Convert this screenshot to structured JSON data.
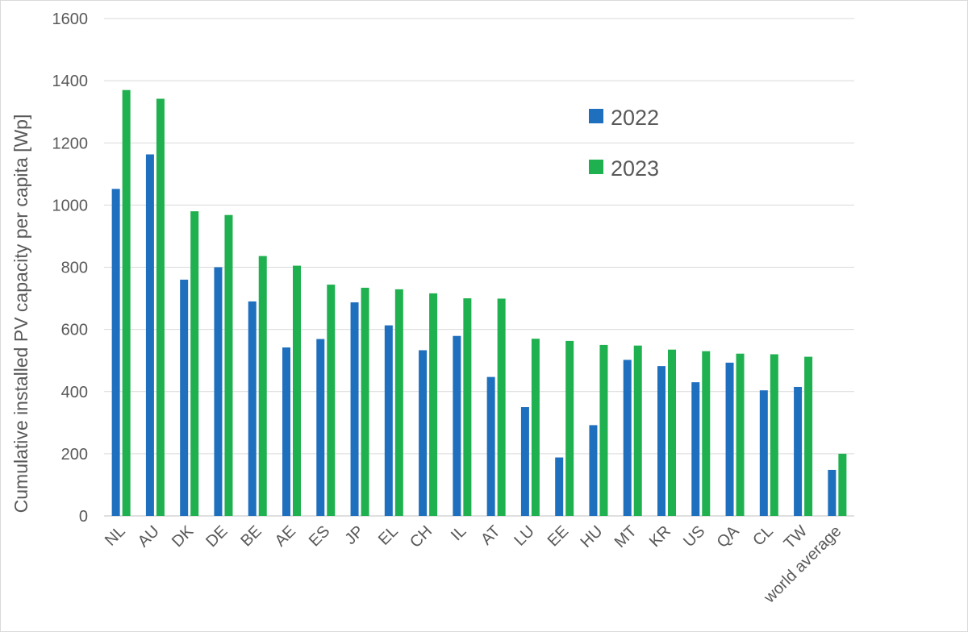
{
  "chart_data": {
    "type": "bar",
    "title": "",
    "xlabel": "",
    "ylabel": "Cumulative installed PV capacity per capita  [Wp]",
    "ylim": [
      0,
      1600
    ],
    "yticks": [
      0,
      200,
      400,
      600,
      800,
      1000,
      1200,
      1400,
      1600
    ],
    "grid": true,
    "legend_position": "upper-right-inside",
    "categories": [
      "NL",
      "AU",
      "DK",
      "DE",
      "BE",
      "AE",
      "ES",
      "JP",
      "EL",
      "CH",
      "IL",
      "AT",
      "LU",
      "EE",
      "HU",
      "MT",
      "KR",
      "US",
      "QA",
      "CL",
      "TW",
      "world average"
    ],
    "series": [
      {
        "name": "2022",
        "color": "#1f6fbf",
        "values": [
          1052,
          1163,
          760,
          800,
          690,
          542,
          569,
          687,
          613,
          533,
          579,
          447,
          350,
          188,
          292,
          502,
          482,
          430,
          493,
          404,
          415,
          148
        ]
      },
      {
        "name": "2023",
        "color": "#1fb14f",
        "values": [
          1370,
          1342,
          980,
          968,
          836,
          805,
          744,
          734,
          729,
          716,
          700,
          699,
          570,
          563,
          550,
          548,
          535,
          530,
          522,
          520,
          512,
          200
        ]
      }
    ]
  }
}
